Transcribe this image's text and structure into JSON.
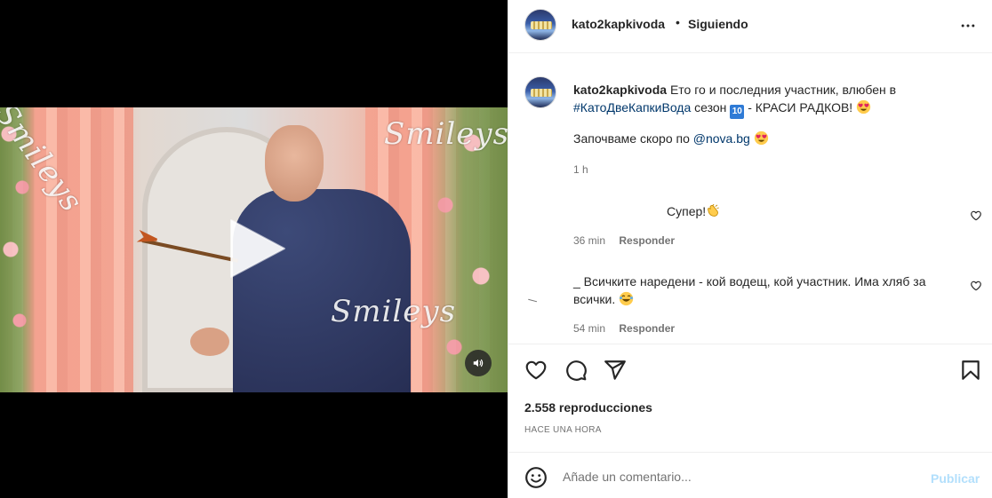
{
  "post": {
    "username": "kato2kapkivoda",
    "separator": "•",
    "follow_status": "Siguiendo",
    "more_icon": "more-horizontal-icon"
  },
  "media": {
    "watermarks": [
      "Smileys",
      "Smileys",
      "Smileys"
    ],
    "play_icon": "play-icon",
    "mute_icon": "volume-icon"
  },
  "caption": {
    "username": "kato2kapkivoda",
    "text_1": "Ето го и последния участник, влюбен в",
    "hashtag": "#КатоДвеКапкиВода",
    "text_2": "сезон",
    "season_badge": "10",
    "text_3": "- КРАСИ РАДКОВ!",
    "line_2_text": "Започваме скоро по",
    "mention": "@nova.bg",
    "time": "1 h"
  },
  "comments": [
    {
      "text": "Супер!",
      "time": "36 min",
      "reply_label": "Responder"
    },
    {
      "text": "_ Всичките наредени - кой водещ, кой участник. Има хляб за всички.",
      "time": "54 min",
      "reply_label": "Responder"
    }
  ],
  "actions": {
    "icons": [
      "heart-icon",
      "comment-icon",
      "share-icon",
      "bookmark-icon"
    ]
  },
  "stats": {
    "views": "2.558 reproducciones",
    "posted_ago": "HACE UNA HORA"
  },
  "add_comment": {
    "placeholder": "Añade un comentario...",
    "post_label": "Publicar"
  },
  "colors": {
    "link": "#00376b",
    "muted": "#737373",
    "publish_disabled": "#b2dffc"
  }
}
